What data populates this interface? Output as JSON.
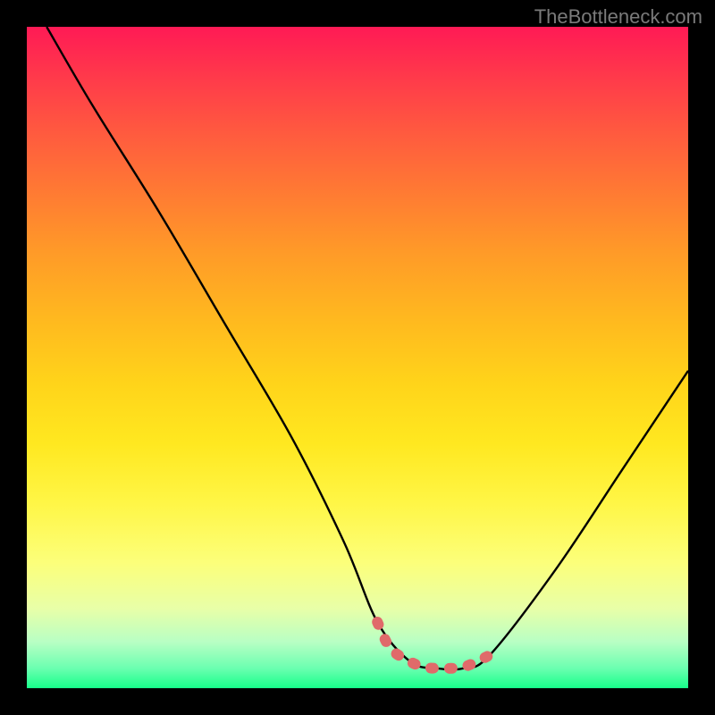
{
  "watermark": "TheBottleneck.com",
  "chart_data": {
    "type": "line",
    "title": "",
    "xlabel": "",
    "ylabel": "",
    "xlim": [
      0,
      100
    ],
    "ylim": [
      0,
      100
    ],
    "grid": false,
    "series": [
      {
        "name": "curve",
        "x": [
          3,
          10,
          20,
          30,
          40,
          48,
          53,
          58,
          62,
          66,
          70,
          80,
          90,
          100
        ],
        "y": [
          100,
          88,
          72,
          55,
          38,
          22,
          10,
          4,
          3,
          3,
          5,
          18,
          33,
          48
        ],
        "color": "#000000"
      },
      {
        "name": "highlight",
        "x": [
          53,
          55,
          58,
          60,
          62,
          64,
          66,
          68,
          70
        ],
        "y": [
          10,
          6,
          4,
          3.2,
          3,
          3,
          3.2,
          4,
          5
        ],
        "color": "#e06a6a"
      }
    ]
  }
}
